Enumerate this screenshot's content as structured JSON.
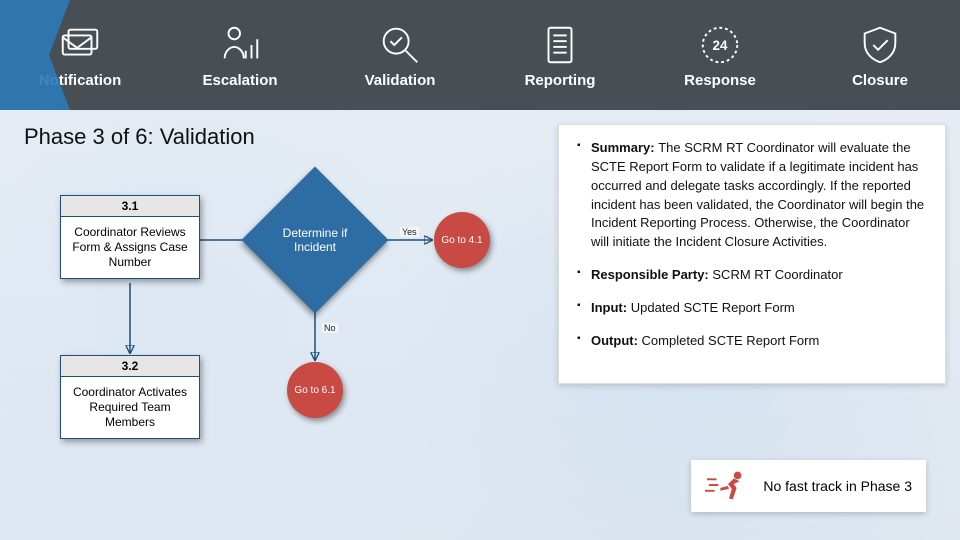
{
  "nav": [
    {
      "label": "Notification",
      "icon": "mail-icon"
    },
    {
      "label": "Escalation",
      "icon": "person-bars-icon"
    },
    {
      "label": "Validation",
      "icon": "magnifier-check-icon"
    },
    {
      "label": "Reporting",
      "icon": "document-lines-icon"
    },
    {
      "label": "Response",
      "icon": "clock-24-icon"
    },
    {
      "label": "Closure",
      "icon": "shield-check-icon"
    }
  ],
  "phase_title": "Phase 3 of 6:  Validation",
  "flow": {
    "box31_num": "3.1",
    "box31_txt": "Coordinator Reviews Form & Assigns Case Number",
    "box32_num": "3.2",
    "box32_txt": "Coordinator Activates Required Team Members",
    "decision": "Determine if Incident",
    "goto41": "Go to 4.1",
    "goto61": "Go to 6.1",
    "yes": "Yes",
    "no": "No"
  },
  "info": {
    "summary_lead": "Summary:",
    "summary_body": "The SCRM RT Coordinator will evaluate the SCTE Report Form to validate if a legitimate incident has occurred and delegate tasks accordingly. If the reported incident has been validated, the Coordinator will begin the Incident Reporting Process. Otherwise, the Coordinator will initiate the Incident Closure Activities.",
    "resp_lead": "Responsible Party:",
    "resp_body": "SCRM RT Coordinator",
    "input_lead": "Input:",
    "input_body": "Updated SCTE Report Form",
    "output_lead": "Output:",
    "output_body": "Completed SCTE Report Form"
  },
  "fast_track": "No fast track in Phase 3",
  "colors": {
    "nav_bg": "#474f54",
    "accent": "#2e6da4",
    "danger": "#c84a42"
  }
}
